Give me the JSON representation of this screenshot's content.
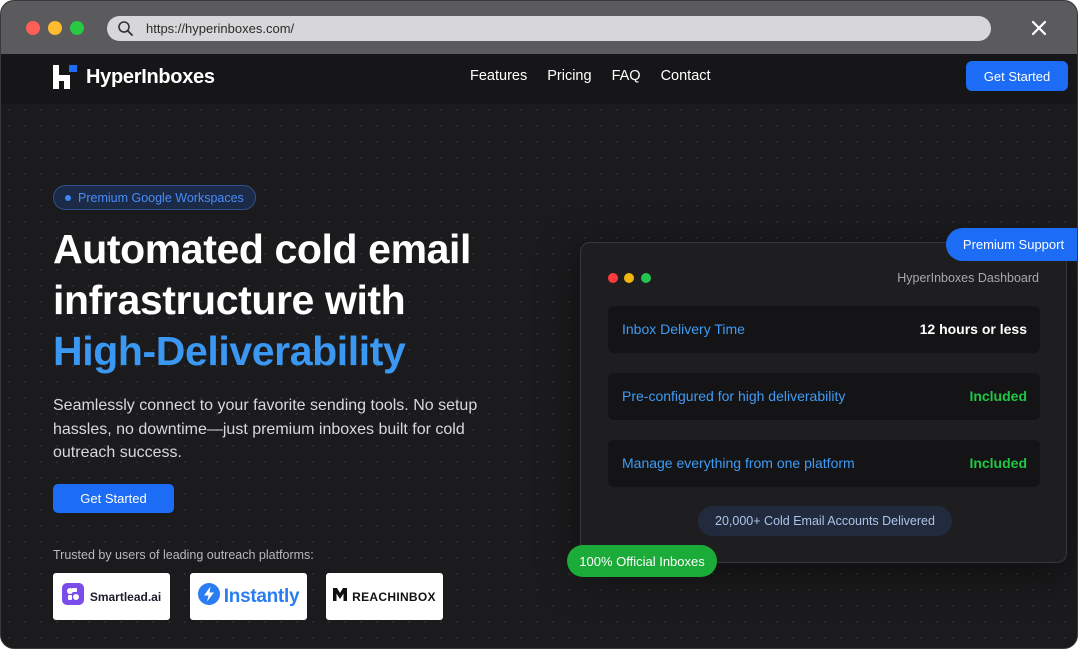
{
  "browser": {
    "url": "https://hyperinboxes.com/"
  },
  "nav": {
    "brand": "HyperInboxes",
    "links": [
      "Features",
      "Pricing",
      "FAQ",
      "Contact"
    ],
    "cta": "Get Started"
  },
  "hero": {
    "badge": "Premium Google Workspaces",
    "headline_line1": "Automated cold email",
    "headline_line2": "infrastructure with",
    "headline_accent": "High-Deliverability",
    "subtext": "Seamlessly connect to your favorite sending tools. No setup hassles, no downtime—just premium inboxes built for cold outreach success.",
    "cta": "Get Started",
    "trusted_text": "Trusted by users of leading outreach platforms:",
    "partners": [
      "Smartlead.ai",
      "Instantly",
      "REACHINBOX"
    ]
  },
  "dashboard": {
    "title": "HyperInboxes Dashboard",
    "rows": [
      {
        "label": "Inbox Delivery Time",
        "value": "12 hours or less"
      },
      {
        "label": "Pre-configured for high deliverability",
        "value": "Included"
      },
      {
        "label": "Manage everything from one platform",
        "value": "Included"
      }
    ],
    "delivered": "20,000+ Cold Email Accounts Delivered",
    "support_pill": "Premium Support",
    "official_pill": "100% Official Inboxes"
  },
  "colors": {
    "accent_blue": "#1d6cf5",
    "headline_accent": "#3a97f2",
    "included_green": "#1fc745",
    "background": "#1b1b1d"
  }
}
